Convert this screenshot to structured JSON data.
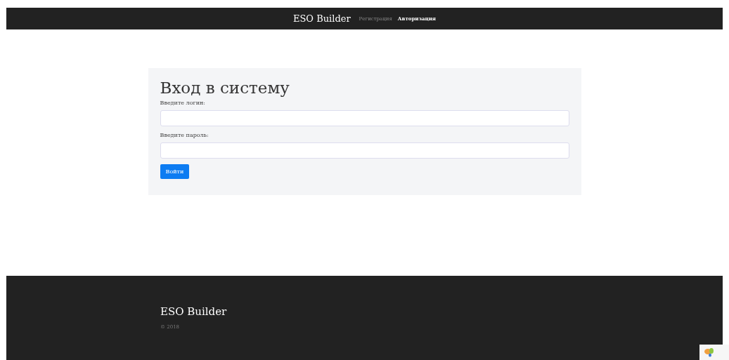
{
  "navbar": {
    "brand": "ESO Builder",
    "links": [
      {
        "label": "Регистрация",
        "selected": false
      },
      {
        "label": "Авторизация",
        "selected": true
      }
    ]
  },
  "login_form": {
    "title": "Вход в систему",
    "fields": [
      {
        "label": "Введите логин:"
      },
      {
        "label": "Введите пароль:"
      }
    ],
    "submit": "Войти"
  },
  "footer": {
    "brand": "ESO Builder",
    "copyright": "© 2018"
  }
}
